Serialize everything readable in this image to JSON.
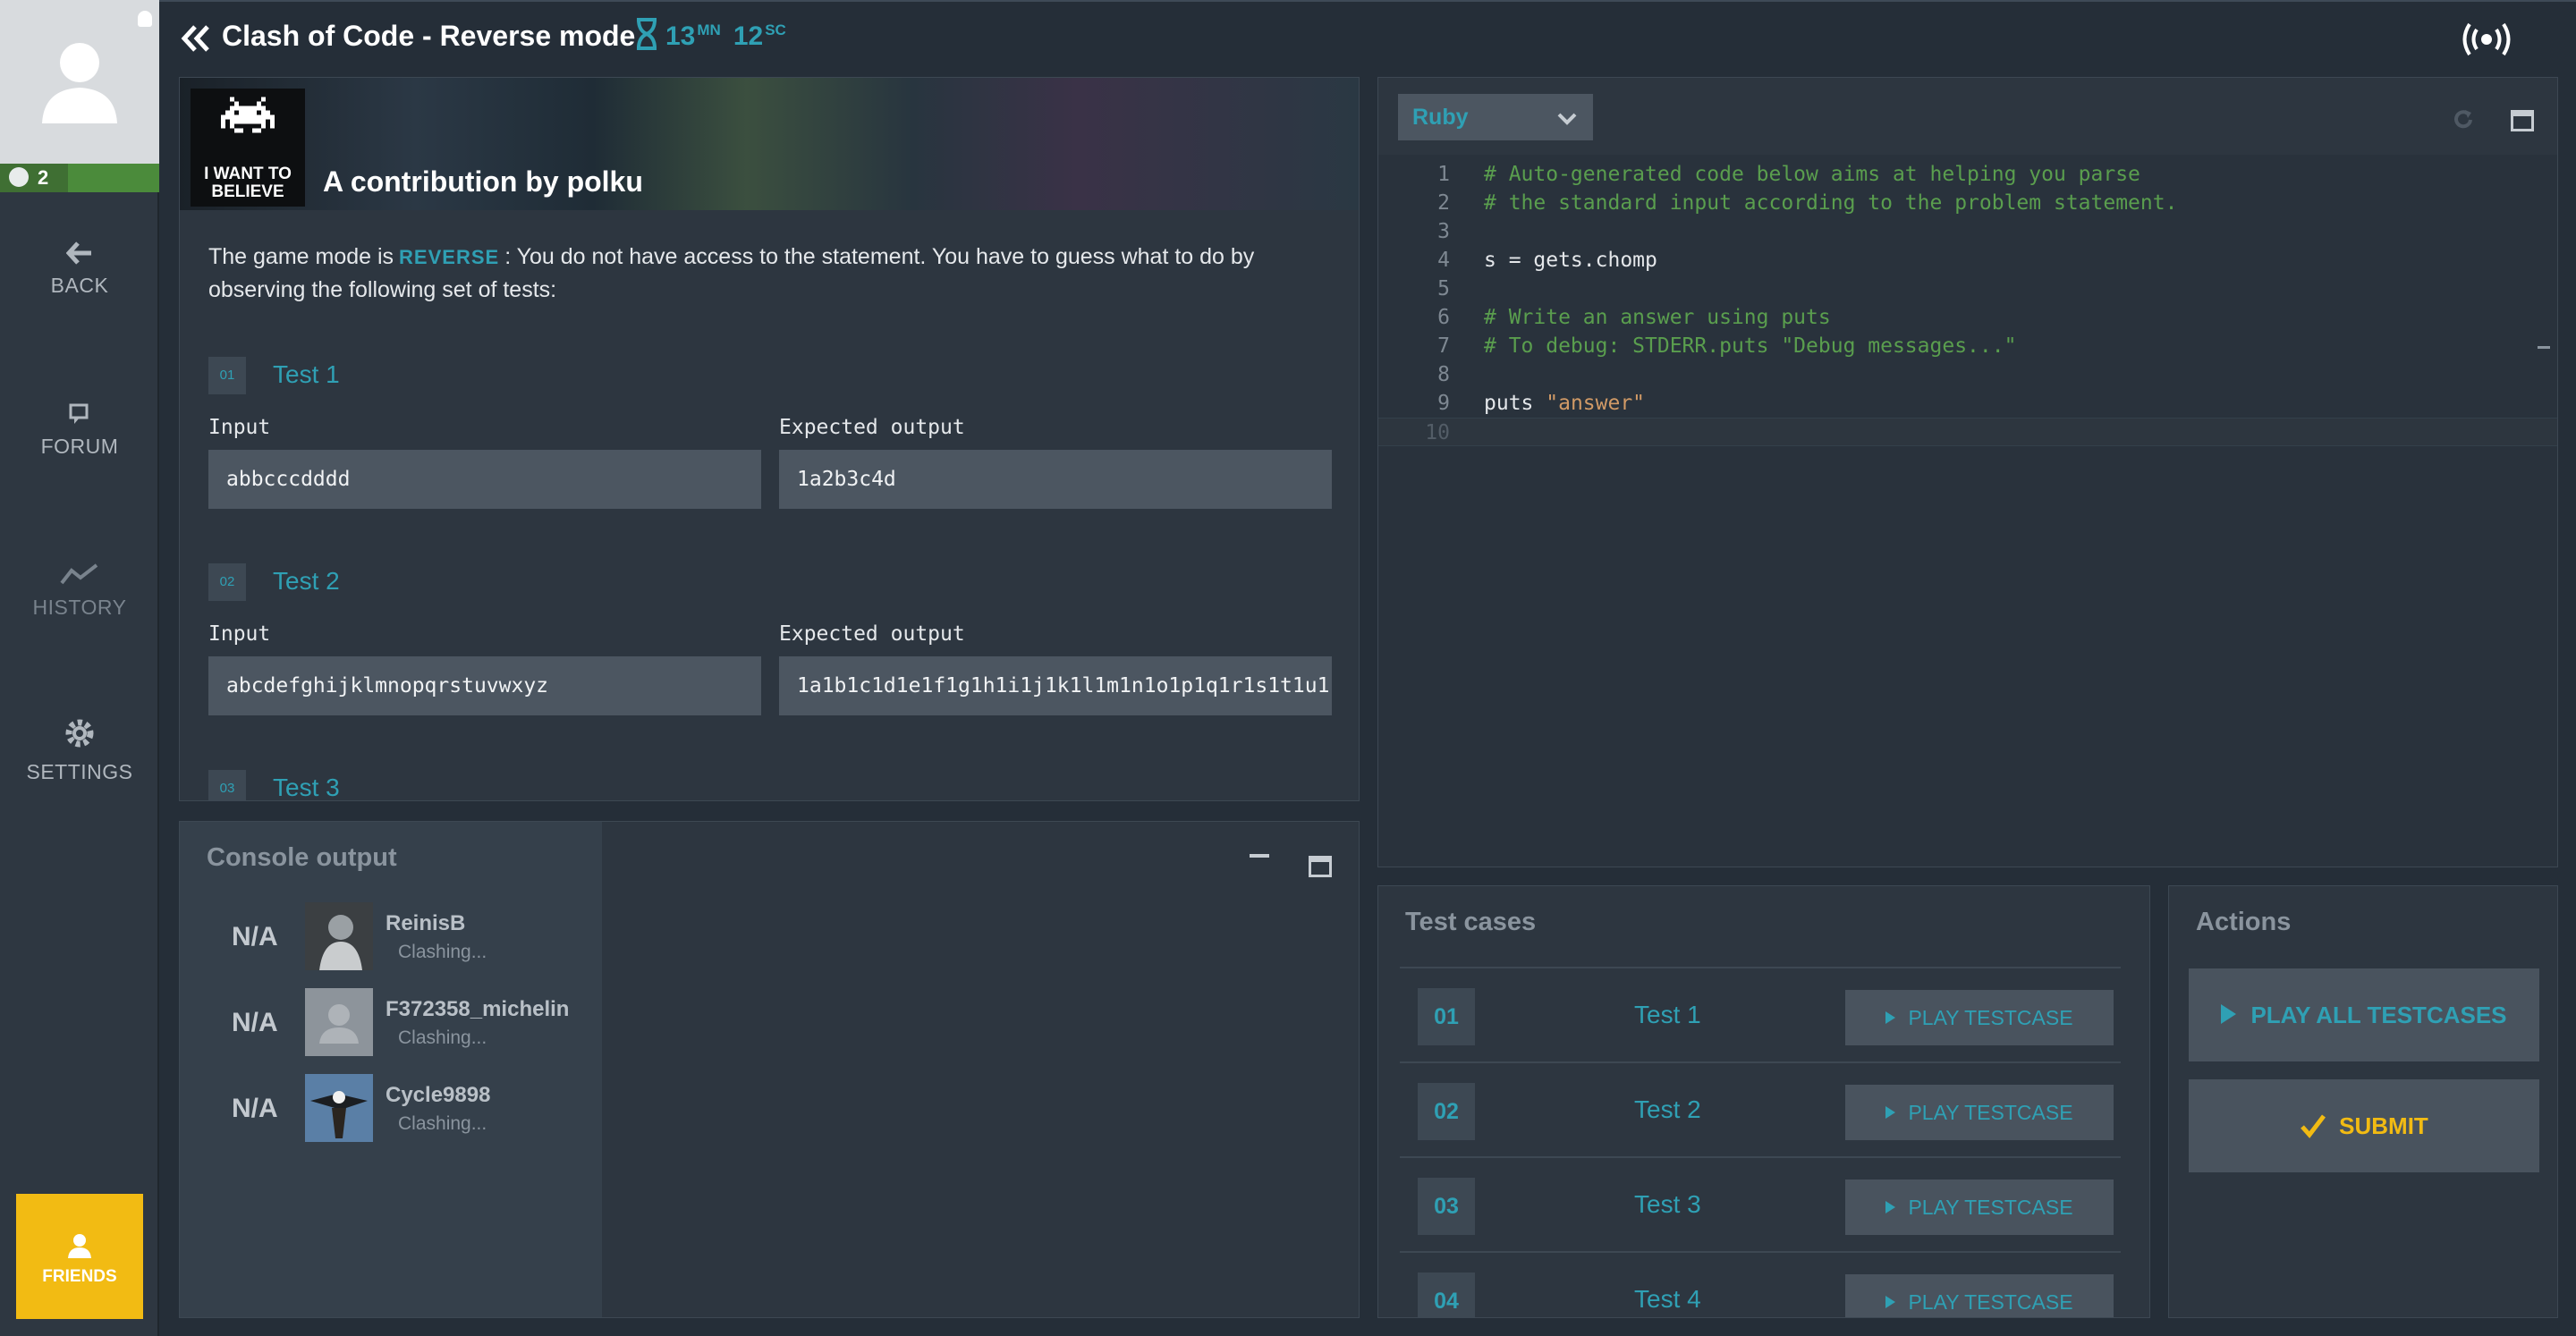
{
  "nav": {
    "level": "2",
    "back": "BACK",
    "forum": "FORUM",
    "history": "HISTORY",
    "settings": "SETTINGS",
    "friends": "FRIENDS"
  },
  "header": {
    "title": "Clash of Code - Reverse mode",
    "timer_minutes": "13",
    "timer_minutes_unit": "MN",
    "timer_seconds": "12",
    "timer_seconds_unit": "SC"
  },
  "statement": {
    "badge_text_1": "I WANT TO",
    "badge_text_2": "BELIEVE",
    "author": "A contribution by polku",
    "desc_before": "The game mode is",
    "mode": "REVERSE",
    "desc_after": ": You do not have access to the statement. You have to guess what to do by observing the following set of tests:",
    "input_label": "Input",
    "output_label": "Expected output",
    "tests": [
      {
        "num": "01",
        "name": "Test 1",
        "input": "abbcccdddd",
        "output": "1a2b3c4d"
      },
      {
        "num": "02",
        "name": "Test 2",
        "input": "abcdefghijklmnopqrstuvwxyz",
        "output": "1a1b1c1d1e1f1g1h1i1j1k1l1m1n1o1p1q1r1s1t1u1"
      },
      {
        "num": "03",
        "name": "Test 3"
      }
    ]
  },
  "console": {
    "title": "Console output",
    "players": [
      {
        "score": "N/A",
        "name": "ReinisB",
        "status": "Clashing..."
      },
      {
        "score": "N/A",
        "name": "F372358_michelin",
        "status": "Clashing..."
      },
      {
        "score": "N/A",
        "name": "Cycle9898",
        "status": "Clashing..."
      }
    ]
  },
  "editor": {
    "language": "Ruby",
    "lines": [
      {
        "no": "1",
        "text": "# Auto-generated code below aims at helping you parse"
      },
      {
        "no": "2",
        "text": "# the standard input according to the problem statement."
      },
      {
        "no": "3",
        "text": ""
      },
      {
        "no": "4",
        "text": "s = gets.chomp"
      },
      {
        "no": "5",
        "text": ""
      },
      {
        "no": "6",
        "text": "# Write an answer using puts"
      },
      {
        "no": "7",
        "text": "# To debug: STDERR.puts \"Debug messages...\""
      },
      {
        "no": "8",
        "text": ""
      },
      {
        "no": "9",
        "text": "puts \"answer\""
      },
      {
        "no": "10",
        "text": ""
      }
    ]
  },
  "testcases": {
    "title": "Test cases",
    "play_label": "PLAY TESTCASE",
    "items": [
      {
        "num": "01",
        "name": "Test 1"
      },
      {
        "num": "02",
        "name": "Test 2"
      },
      {
        "num": "03",
        "name": "Test 3"
      },
      {
        "num": "04",
        "name": "Test 4"
      }
    ]
  },
  "actions": {
    "title": "Actions",
    "play_all": "PLAY ALL TESTCASES",
    "submit": "SUBMIT"
  },
  "colors": {
    "accent": "#2fa0b4",
    "friends": "#f2bb13",
    "level_green": "#4b8b3b",
    "code_comment": "#5a9e4e",
    "code_string": "#d19a66"
  }
}
